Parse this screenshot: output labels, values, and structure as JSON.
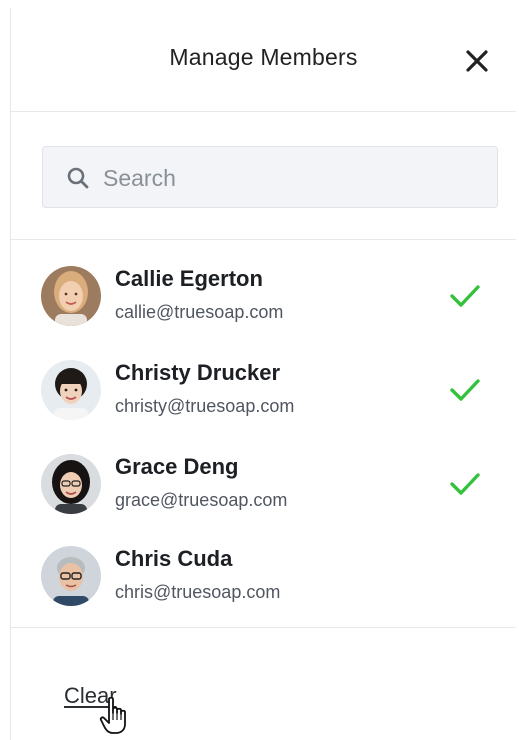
{
  "header": {
    "title": "Manage Members",
    "close_icon": "close-icon"
  },
  "search": {
    "placeholder": "Search",
    "value": "",
    "icon": "search-icon"
  },
  "members": [
    {
      "name": "Callie Egerton",
      "email": "callie@truesoap.com",
      "selected": true
    },
    {
      "name": "Christy Drucker",
      "email": "christy@truesoap.com",
      "selected": true
    },
    {
      "name": "Grace Deng",
      "email": "grace@truesoap.com",
      "selected": true
    },
    {
      "name": "Chris Cuda",
      "email": "chris@truesoap.com",
      "selected": false
    }
  ],
  "footer": {
    "clear_label": "Clear"
  },
  "colors": {
    "check": "#34c23c",
    "search_bg": "#f2f4f7"
  }
}
